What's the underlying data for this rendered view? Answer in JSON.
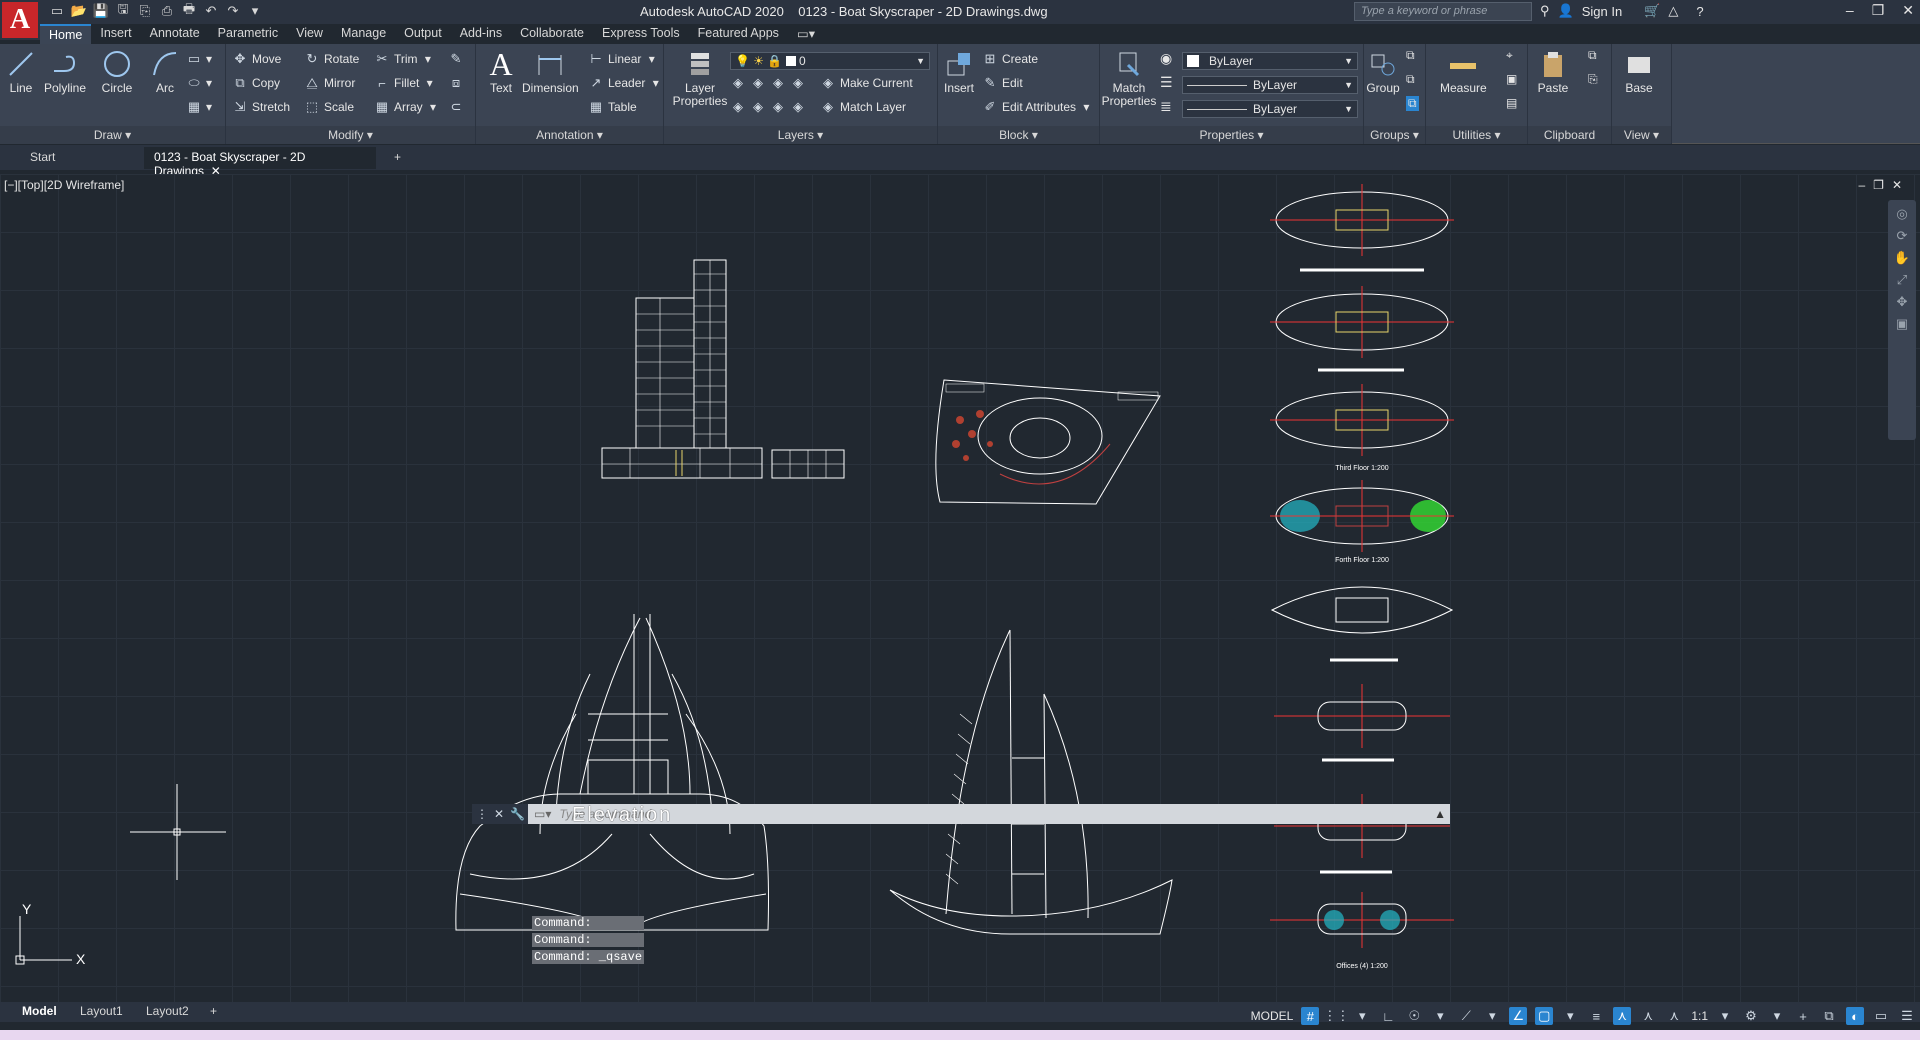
{
  "window": {
    "app_title": "Autodesk AutoCAD 2020",
    "doc_title": "0123 - Boat Skyscraper - 2D Drawings.dwg",
    "search_placeholder": "Type a keyword or phrase",
    "sign_in": "Sign In"
  },
  "menu": {
    "tabs": [
      "Home",
      "Insert",
      "Annotate",
      "Parametric",
      "View",
      "Manage",
      "Output",
      "Add-ins",
      "Collaborate",
      "Express Tools",
      "Featured Apps"
    ]
  },
  "ribbon": {
    "draw": {
      "title": "Draw",
      "line": "Line",
      "polyline": "Polyline",
      "circle": "Circle",
      "arc": "Arc"
    },
    "modify": {
      "title": "Modify",
      "move": "Move",
      "rotate": "Rotate",
      "trim": "Trim",
      "copy": "Copy",
      "mirror": "Mirror",
      "fillet": "Fillet",
      "stretch": "Stretch",
      "scale": "Scale",
      "array": "Array"
    },
    "annotation": {
      "title": "Annotation",
      "text": "Text",
      "dimension": "Dimension",
      "linear": "Linear",
      "leader": "Leader",
      "table": "Table"
    },
    "layers": {
      "title": "Layers",
      "layer_properties": "Layer Properties",
      "current_layer": "0",
      "make_current": "Make Current",
      "match_layer": "Match Layer"
    },
    "block": {
      "title": "Block",
      "insert": "Insert",
      "create": "Create",
      "edit": "Edit",
      "edit_attributes": "Edit Attributes"
    },
    "properties": {
      "title": "Properties",
      "match_properties": "Match Properties",
      "color": "ByLayer",
      "linetype": "ByLayer",
      "lineweight": "ByLayer"
    },
    "groups": {
      "title": "Groups",
      "group": "Group"
    },
    "utilities": {
      "title": "Utilities",
      "measure": "Measure"
    },
    "clipboard": {
      "title": "Clipboard",
      "paste": "Paste"
    },
    "view": {
      "title": "View",
      "base": "Base"
    }
  },
  "doc_tabs": {
    "start": "Start",
    "active": "0123 - Boat Skyscraper - 2D Drawings"
  },
  "viewport": {
    "label": "[−][Top][2D Wireframe]"
  },
  "command": {
    "history": [
      "Command:",
      "Command:",
      "Command:  _qsave"
    ],
    "placeholder": "Type a command",
    "overlay_text": "Elevation"
  },
  "drawing_labels": {
    "third_floor": "Third Floor 1:200",
    "forth_floor": "Forth Floor 1:200",
    "offices": "Offices (4) 1:200"
  },
  "layout_tabs": [
    "Model",
    "Layout1",
    "Layout2"
  ],
  "status": {
    "model": "MODEL",
    "scale": "1:1"
  },
  "colors": {
    "accent": "#2a85d0",
    "background": "#212830",
    "ribbon": "#3b4453",
    "logo": "#c8262a"
  }
}
